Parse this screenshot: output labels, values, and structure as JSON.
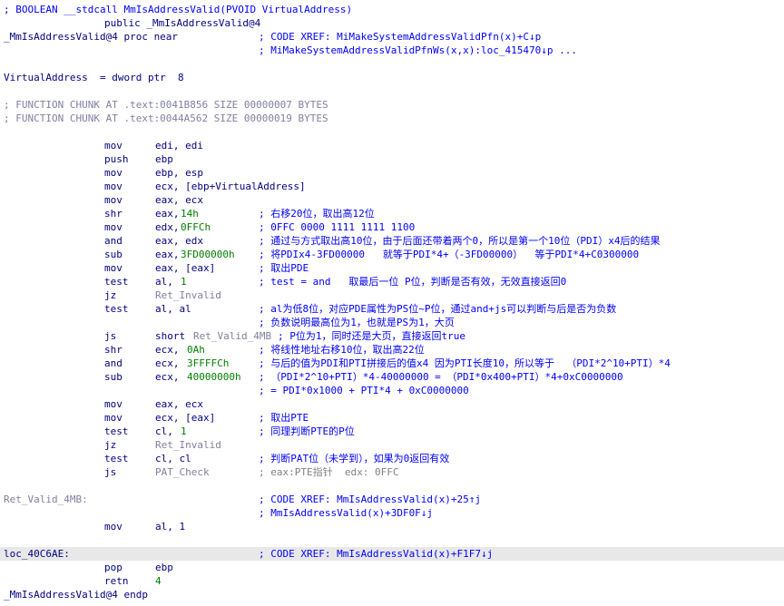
{
  "lines": [
    {
      "cols": [
        [
          "; BOOLEAN __stdcall MmIsAddressValid(PVOID VirtualAddress)",
          "xref"
        ]
      ]
    },
    {
      "cols": [
        [
          "public _MmIsAddressValid@4",
          "name",
          115
        ]
      ]
    },
    {
      "cols": [
        [
          "_MmIsAddressValid@4 proc near",
          "proc"
        ],
        [
          "; CODE XREF: MiMakeSystemAddressValidPfn(x)+C↓p",
          "xref",
          285
        ]
      ]
    },
    {
      "cols": [
        [
          "; MiMakeSystemAddressValidPfnWs(x,x):loc_415470↓p ...",
          "xref",
          285
        ]
      ]
    },
    {
      "cols": []
    },
    {
      "cols": [
        [
          "VirtualAddress  = dword ptr  8",
          "name"
        ]
      ]
    },
    {
      "cols": []
    },
    {
      "cols": [
        [
          "; FUNCTION CHUNK AT .text:0041B856 SIZE 00000007 BYTES",
          "cmt"
        ]
      ]
    },
    {
      "cols": [
        [
          "; FUNCTION CHUNK AT .text:0044A562 SIZE 00000019 BYTES",
          "cmt"
        ]
      ]
    },
    {
      "cols": []
    },
    {
      "cols": [
        [
          "mov",
          "mn",
          115
        ],
        [
          "edi, edi",
          "op",
          171
        ]
      ]
    },
    {
      "cols": [
        [
          "push",
          "mn",
          115
        ],
        [
          "ebp",
          "op",
          171
        ]
      ]
    },
    {
      "cols": [
        [
          "mov",
          "mn",
          115
        ],
        [
          "ebp, esp",
          "op",
          171
        ]
      ]
    },
    {
      "cols": [
        [
          "mov",
          "mn",
          115
        ],
        [
          "ecx, [ebp+VirtualAddress]",
          "op",
          171
        ]
      ]
    },
    {
      "cols": [
        [
          "mov",
          "mn",
          115
        ],
        [
          "eax, ecx",
          "op",
          171
        ]
      ]
    },
    {
      "cols": [
        [
          "shr",
          "mn",
          115
        ],
        [
          "eax, ",
          "op",
          171
        ],
        [
          "14h",
          "num",
          199
        ],
        [
          "; 右移20位，取出高12位",
          "zh",
          285
        ]
      ]
    },
    {
      "cols": [
        [
          "mov",
          "mn",
          115
        ],
        [
          "edx, ",
          "op",
          171
        ],
        [
          "0FFCh",
          "num",
          199
        ],
        [
          "; 0FFC 0000 1111 1111 1100",
          "zh",
          285
        ]
      ]
    },
    {
      "cols": [
        [
          "and",
          "mn",
          115
        ],
        [
          "eax, edx",
          "op",
          171
        ],
        [
          "; 通过与方式取出高10位，由于后面还带着两个0，所以是第一个10位（PDI）x4后的结果",
          "zh",
          285
        ]
      ]
    },
    {
      "cols": [
        [
          "sub",
          "mn",
          115
        ],
        [
          "eax, ",
          "op",
          171
        ],
        [
          "3FD00000h",
          "num",
          199
        ],
        [
          "; 将PDIx4-3FD00000   就等于PDI*4+（-3FD00000）  等于PDI*4+C0300000",
          "zh",
          285
        ]
      ]
    },
    {
      "cols": [
        [
          "mov",
          "mn",
          115
        ],
        [
          "eax, [eax]",
          "op",
          171
        ],
        [
          "; 取出PDE",
          "zh",
          285
        ]
      ]
    },
    {
      "cols": [
        [
          "test",
          "mn",
          115
        ],
        [
          "al, ",
          "op",
          171
        ],
        [
          "1",
          "num",
          199
        ],
        [
          "; test = and   取最后一位 P位，判断是否有效，无效直接返回0",
          "zh",
          285
        ]
      ]
    },
    {
      "cols": [
        [
          "jz",
          "mn",
          115
        ],
        [
          "Ret_Invalid",
          "label",
          171
        ]
      ]
    },
    {
      "cols": [
        [
          "test",
          "mn",
          115
        ],
        [
          "al, al",
          "op",
          171
        ],
        [
          "; al为低8位，对应PDE属性为PS位~P位，通过and+js可以判断与后是否为负数",
          "zh",
          285
        ]
      ]
    },
    {
      "cols": [
        [
          "; 负数说明最高位为1，也就是PS为1，大页",
          "zh",
          285
        ]
      ]
    },
    {
      "cols": [
        [
          "js",
          "mn",
          115
        ],
        [
          "short ",
          "op",
          171
        ],
        [
          "Ret_Valid_4MB",
          "label",
          213
        ],
        [
          "; P位为1，同时还是大页，直接返回true",
          "zh",
          306
        ]
      ]
    },
    {
      "cols": [
        [
          "shr",
          "mn",
          115
        ],
        [
          "ecx, ",
          "op",
          171
        ],
        [
          "0Ah",
          "num",
          206
        ],
        [
          "; 将线性地址右移10位，取出高22位",
          "zh",
          285
        ]
      ]
    },
    {
      "cols": [
        [
          "and",
          "mn",
          115
        ],
        [
          "ecx, ",
          "op",
          171
        ],
        [
          "3FFFFCh",
          "num",
          206
        ],
        [
          "; 与后的值为PDI和PTI拼接后的值x4 因为PTI长度10，所以等于  （PDI*2^10+PTI）*4",
          "zh",
          285
        ]
      ]
    },
    {
      "cols": [
        [
          "sub",
          "mn",
          115
        ],
        [
          "ecx, ",
          "op",
          171
        ],
        [
          "40000000h",
          "num",
          206
        ],
        [
          "; （PDI*2^10+PTI）*4-40000000 = （PDI*0x400+PTI）*4+0xC0000000",
          "zh",
          285
        ]
      ]
    },
    {
      "cols": [
        [
          "; = PDI*0x1000 + PTI*4 + 0xC0000000",
          "zh",
          285
        ]
      ]
    },
    {
      "cols": [
        [
          "mov",
          "mn",
          115
        ],
        [
          "eax, ecx",
          "op",
          171
        ]
      ]
    },
    {
      "cols": [
        [
          "mov",
          "mn",
          115
        ],
        [
          "ecx, [eax]",
          "op",
          171
        ],
        [
          "; 取出PTE",
          "zh",
          285
        ]
      ]
    },
    {
      "cols": [
        [
          "test",
          "mn",
          115
        ],
        [
          "cl, ",
          "op",
          171
        ],
        [
          "1",
          "num",
          199
        ],
        [
          "; 同理判断PTE的P位",
          "zh",
          285
        ]
      ]
    },
    {
      "cols": [
        [
          "jz",
          "mn",
          115
        ],
        [
          "Ret_Invalid",
          "label",
          171
        ]
      ]
    },
    {
      "cols": [
        [
          "test",
          "mn",
          115
        ],
        [
          "cl, cl",
          "op",
          171
        ],
        [
          "; 判断PAT位（未学到），如果为0返回有效",
          "zh",
          285
        ]
      ]
    },
    {
      "cols": [
        [
          "js",
          "mn",
          115
        ],
        [
          "PAT_Check",
          "label",
          171
        ],
        [
          "; eax:PTE指针  edx: 0FFC",
          "dim",
          285
        ]
      ]
    },
    {
      "cols": []
    },
    {
      "cols": [
        [
          "Ret_Valid_4MB:",
          "label"
        ],
        [
          "; CODE XREF: MmIsAddressValid(x)+25↑j",
          "xref",
          285
        ]
      ]
    },
    {
      "cols": [
        [
          "; MmIsAddressValid(x)+3DF0F↓j",
          "xref",
          285
        ]
      ]
    },
    {
      "cols": [
        [
          "mov",
          "mn",
          115
        ],
        [
          "al, 1",
          "op",
          171
        ]
      ]
    },
    {
      "cols": []
    },
    {
      "cols": [
        [
          "loc_40C6AE:",
          "name"
        ],
        [
          "; CODE XREF: MmIsAddressValid(x)+F1F7↓j",
          "xref",
          285
        ]
      ],
      "highlight": true
    },
    {
      "cols": [
        [
          "pop",
          "mn",
          115
        ],
        [
          "ebp",
          "op",
          171
        ]
      ]
    },
    {
      "cols": [
        [
          "retn",
          "mn",
          115
        ],
        [
          "4",
          "num",
          171
        ]
      ]
    },
    {
      "cols": [
        [
          "_MmIsAddressValid@4 endp",
          "proc"
        ]
      ]
    }
  ]
}
